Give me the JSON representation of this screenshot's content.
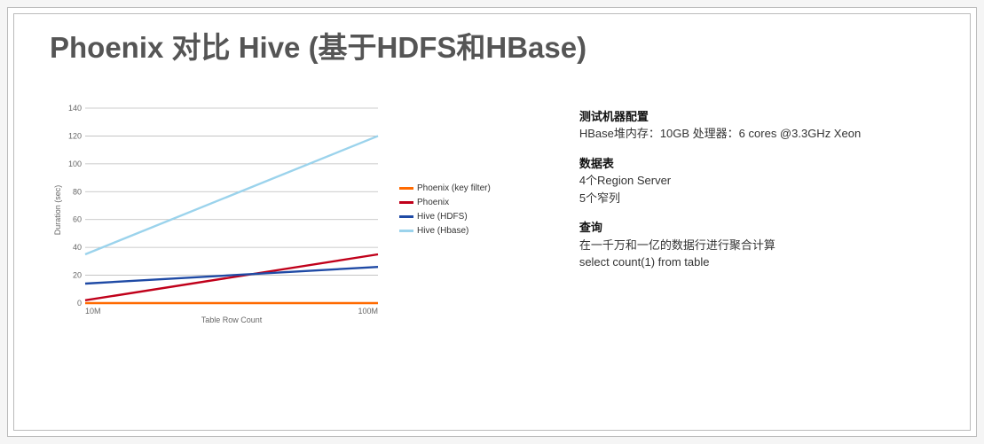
{
  "title": "Phoenix 对比 Hive (基于HDFS和HBase)",
  "chart_data": {
    "type": "line",
    "title": "",
    "xlabel": "Table Row Count",
    "ylabel": "Duration (sec)",
    "ylim": [
      0,
      140
    ],
    "yticks": [
      0,
      20,
      40,
      60,
      80,
      100,
      120,
      140
    ],
    "categories": [
      "10M",
      "100M"
    ],
    "series": [
      {
        "name": "Phoenix (key filter)",
        "color": "#ff6a00",
        "values": [
          0,
          0
        ]
      },
      {
        "name": "Phoenix",
        "color": "#c0001a",
        "values": [
          2,
          35
        ]
      },
      {
        "name": "Hive (HDFS)",
        "color": "#1f4aa5",
        "values": [
          14,
          26
        ]
      },
      {
        "name": "Hive (Hbase)",
        "color": "#9bd3ec",
        "values": [
          35,
          120
        ]
      }
    ]
  },
  "legend": [
    {
      "label": "Phoenix (key filter)",
      "color": "#ff6a00"
    },
    {
      "label": "Phoenix",
      "color": "#c0001a"
    },
    {
      "label": "Hive (HDFS)",
      "color": "#1f4aa5"
    },
    {
      "label": "Hive (Hbase)",
      "color": "#9bd3ec"
    }
  ],
  "side": {
    "h1": "测试机器配置",
    "p1": "HBase堆内存：10GB 处理器：6 cores @3.3GHz Xeon",
    "h2": "数据表",
    "p2a": "4个Region Server",
    "p2b": "5个窄列",
    "h3": "查询",
    "p3a": "在一千万和一亿的数据行进行聚合计算",
    "p3b": "select count(1) from table"
  },
  "chart_labels": {
    "ylabel": "Duration (sec)",
    "xlabel": "Table Row Count",
    "xtick0": "10M",
    "xtick1": "100M"
  }
}
